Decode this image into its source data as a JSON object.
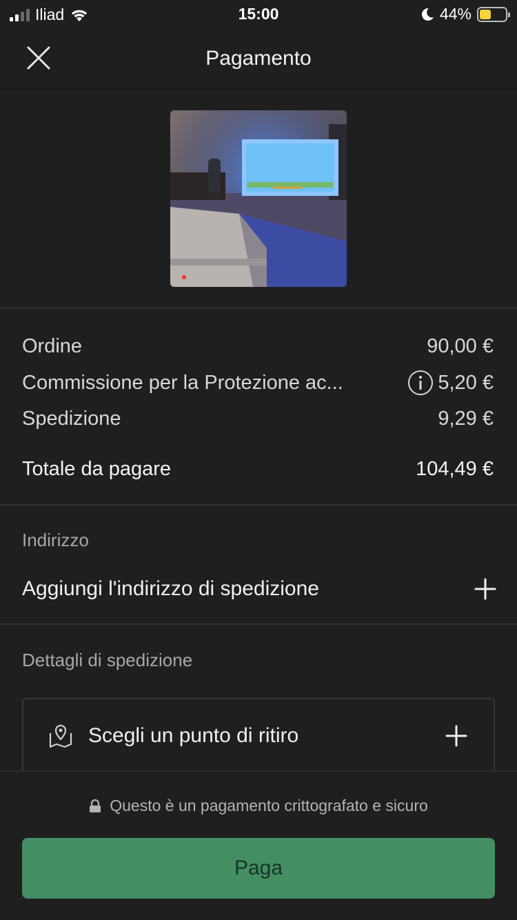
{
  "status_bar": {
    "carrier": "Iliad",
    "time": "15:00",
    "battery_percent": "44%",
    "battery_level": 0.44,
    "icons": [
      "signal-icon",
      "wifi-icon",
      "moon-icon",
      "battery-icon"
    ]
  },
  "header": {
    "title": "Pagamento",
    "close_icon": "close-icon"
  },
  "summary": {
    "order_label": "Ordine",
    "order_value": "90,00 €",
    "fee_label": "Commissione per la Protezione ac...",
    "fee_value": "5,20 €",
    "shipping_label": "Spedizione",
    "shipping_value": "9,29 €",
    "total_label": "Totale da pagare",
    "total_value": "104,49 €"
  },
  "address": {
    "section_label": "Indirizzo",
    "add_label": "Aggiungi l'indirizzo di spedizione",
    "add_icon": "plus-icon"
  },
  "shipping_details": {
    "section_label": "Dettagli di spedizione",
    "pickup_label": "Scegli un punto di ritiro",
    "pickup_icon": "map-pin-icon"
  },
  "footer": {
    "secure_text": "Questo è un pagamento crittografato e sicuro",
    "pay_label": "Paga"
  },
  "colors": {
    "background": "#1f1f1f",
    "accent_green": "#438f63",
    "battery_yellow": "#f5d33c"
  }
}
